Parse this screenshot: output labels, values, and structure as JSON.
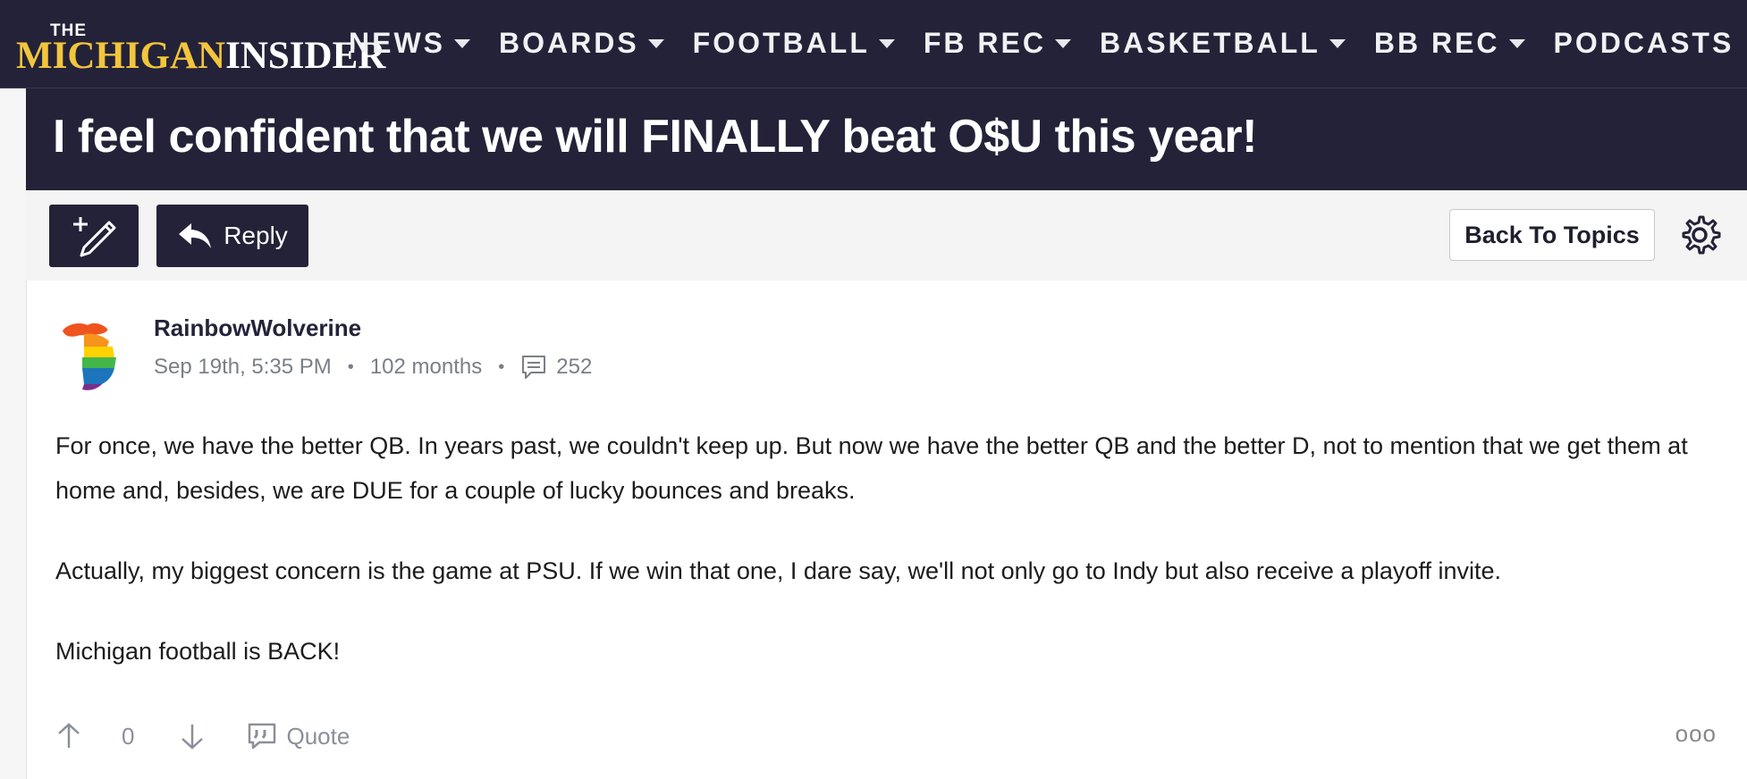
{
  "site": {
    "logo_the": "THE",
    "logo_michigan": "MICHIGAN",
    "logo_insider": "INSIDER",
    "brand_navy": "#242238",
    "brand_maize": "#f2c53d"
  },
  "nav": {
    "items": [
      {
        "label": "NEWS",
        "has_dropdown": true
      },
      {
        "label": "BOARDS",
        "has_dropdown": true
      },
      {
        "label": "FOOTBALL",
        "has_dropdown": true
      },
      {
        "label": "FB REC",
        "has_dropdown": true
      },
      {
        "label": "BASKETBALL",
        "has_dropdown": true
      },
      {
        "label": "BB REC",
        "has_dropdown": true
      },
      {
        "label": "PODCASTS",
        "has_dropdown": false
      }
    ],
    "more": "•••"
  },
  "topic": {
    "title": "I feel confident that we will FINALLY beat O$U this year!"
  },
  "toolbar": {
    "new_topic_icon": "pencil-plus-icon",
    "reply_label": "Reply",
    "back_label": "Back To Topics",
    "settings_icon": "gear-icon"
  },
  "post": {
    "author": "RainbowWolverine",
    "date": "Sep 19th, 5:35 PM",
    "tenure": "102 months",
    "post_count": "252",
    "paragraphs": [
      "For once, we have the better QB. In years past, we couldn't keep up. But now we have the better QB and the better D, not to mention that we get them at home and, besides, we are DUE for a couple of lucky bounces and breaks.",
      "Actually, my biggest concern is the game at PSU. If we win that one, I dare say, we'll not only go to Indy but also receive a playoff invite.",
      "Michigan football is BACK!"
    ],
    "votes": "0",
    "quote_label": "Quote",
    "more_label": "ooo"
  }
}
